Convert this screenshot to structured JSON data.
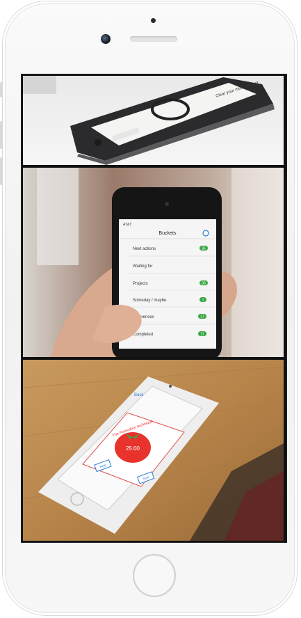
{
  "photos": [
    {
      "caption": "",
      "screen_text": {
        "header": "Clear your mind. Collect"
      }
    },
    {
      "caption": "",
      "screen_text": {
        "carrier": "AT&T",
        "title": "Buckets",
        "rows": [
          {
            "label": "Next actions",
            "count": "35"
          },
          {
            "label": "Waiting for",
            "count": ""
          },
          {
            "label": "Projects",
            "count": "33"
          },
          {
            "label": "Someday / maybe",
            "count": "1"
          },
          {
            "label": "References",
            "count": "17"
          },
          {
            "label": "Completed",
            "count": "11"
          }
        ]
      }
    },
    {
      "caption": "",
      "screen_text": {
        "back": "Back",
        "dialog_title": "The Pomodoro technique",
        "timer": "25:00",
        "left_button": "Help",
        "right_button": "Start"
      }
    }
  ],
  "colors": {
    "accent_green": "#3aa845",
    "tomato_red": "#e8322c",
    "ios_blue": "#2a7fd6"
  }
}
